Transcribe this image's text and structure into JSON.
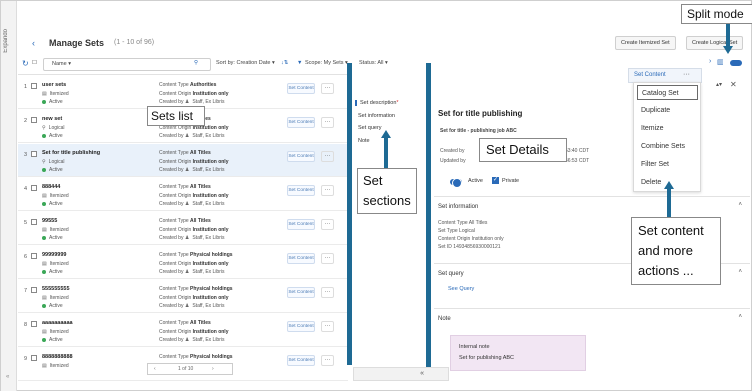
{
  "rail": {
    "label": "Expando",
    "bottom": "«"
  },
  "header": {
    "title": "Manage Sets",
    "count": "(1 - 10 of 96)",
    "create_itemized": "Create Itemized Set",
    "create_logical": "Create Logical Set"
  },
  "toolbar": {
    "name_label": "Name ▾",
    "search_icon": "⚲",
    "sort": "Sort by: Creation Date ▾",
    "sort_dir": "↓⇅",
    "filter_icon": "▼",
    "scope": "Scope: My Sets ▾",
    "status": "Status: All ▾"
  },
  "rows": [
    {
      "num": "1",
      "name": "user sets",
      "kind": "Itemized",
      "status": "Active",
      "ct": "Authorities",
      "origin": "Institution only",
      "by": "Staff, Ex Libris",
      "set_content": "Set Content",
      "more": "···"
    },
    {
      "num": "2",
      "name": "new set",
      "kind": "Logical",
      "status": "Active",
      "ct": "All Titles",
      "origin": "Institution only",
      "by": "Staff, Ex Libris",
      "set_content": "Set Content",
      "more": "···"
    },
    {
      "num": "3",
      "name": "Set for title publishing",
      "kind": "Logical",
      "status": "Active",
      "ct": "All Titles",
      "origin": "Institution only",
      "by": "Staff, Ex Libris",
      "set_content": "Set Content",
      "more": "···"
    },
    {
      "num": "4",
      "name": "888444",
      "kind": "Itemized",
      "status": "Active",
      "ct": "All Titles",
      "origin": "Institution only",
      "by": "Staff, Ex Libris",
      "set_content": "Set Content",
      "more": "···"
    },
    {
      "num": "5",
      "name": "99555",
      "kind": "Itemized",
      "status": "Active",
      "ct": "All Titles",
      "origin": "Institution only",
      "by": "Staff, Ex Libris",
      "set_content": "Set Content",
      "more": "···"
    },
    {
      "num": "6",
      "name": "99999999",
      "kind": "Itemized",
      "status": "Active",
      "ct": "Physical holdings",
      "origin": "Institution only",
      "by": "Staff, Ex Libris",
      "set_content": "Set Content",
      "more": "···"
    },
    {
      "num": "7",
      "name": "555555555",
      "kind": "Itemized",
      "status": "Active",
      "ct": "Physical holdings",
      "origin": "Institution only",
      "by": "Staff, Ex Libris",
      "set_content": "Set Content",
      "more": "···"
    },
    {
      "num": "8",
      "name": "aaaaaaaaaa",
      "kind": "Itemized",
      "status": "Active",
      "ct": "All Titles",
      "origin": "Institution only",
      "by": "Staff, Ex Libris",
      "set_content": "Set Content",
      "more": "···"
    },
    {
      "num": "9",
      "name": "8888888888",
      "kind": "Itemized",
      "status": "",
      "ct": "Physical holdings",
      "origin": "Institution only",
      "by": "",
      "set_content": "Set Content",
      "more": "···"
    }
  ],
  "labels": {
    "content_type": "Content Type ",
    "content_origin": "Content Origin ",
    "created_by": "Created by "
  },
  "pager": {
    "prev": "‹",
    "text": "1 of 10",
    "next": "›"
  },
  "sections": [
    "Set description",
    "Set information",
    "Set query",
    "Note"
  ],
  "sections_required": "*",
  "details": {
    "title": "Set for title publishing",
    "subtitle": "Set for title - publishing job ABC",
    "created_by": "Created by",
    "updated_by": "Updated by",
    "created_time": "06:53:40 CDT",
    "updated_time": "06:46:53 CDT",
    "active": "Active",
    "private": "Private"
  },
  "set_info": {
    "title": "Set information",
    "lines": [
      "Content Type All Titles",
      "Set Type Logical",
      "Content Origin Institution only",
      "Set ID 14934856930000121"
    ]
  },
  "set_query": {
    "title": "Set query",
    "link": "See Query"
  },
  "note": {
    "title": "Note",
    "head": "Internal note",
    "text": "Set for publishing ABC"
  },
  "dropdown": {
    "label": "Set Content",
    "more": "···",
    "items": [
      "Catalog Set",
      "Duplicate",
      "Itemize",
      "Combine Sets",
      "Filter Set",
      "Delete"
    ]
  },
  "collapse": "«",
  "annotations": {
    "split_mode": "Split mode",
    "sets_list": "Sets list",
    "set_details": "Set Details",
    "set_sections_1": "Set",
    "set_sections_2": "sections",
    "more_1": "Set content",
    "more_2": "and more",
    "more_3": "actions ..."
  },
  "colors": {
    "accent": "#2a6ab8",
    "annotation_arrow": "#1e6a94",
    "selected_row": "#e9f1fa",
    "note_bg": "#f2e6f3"
  }
}
